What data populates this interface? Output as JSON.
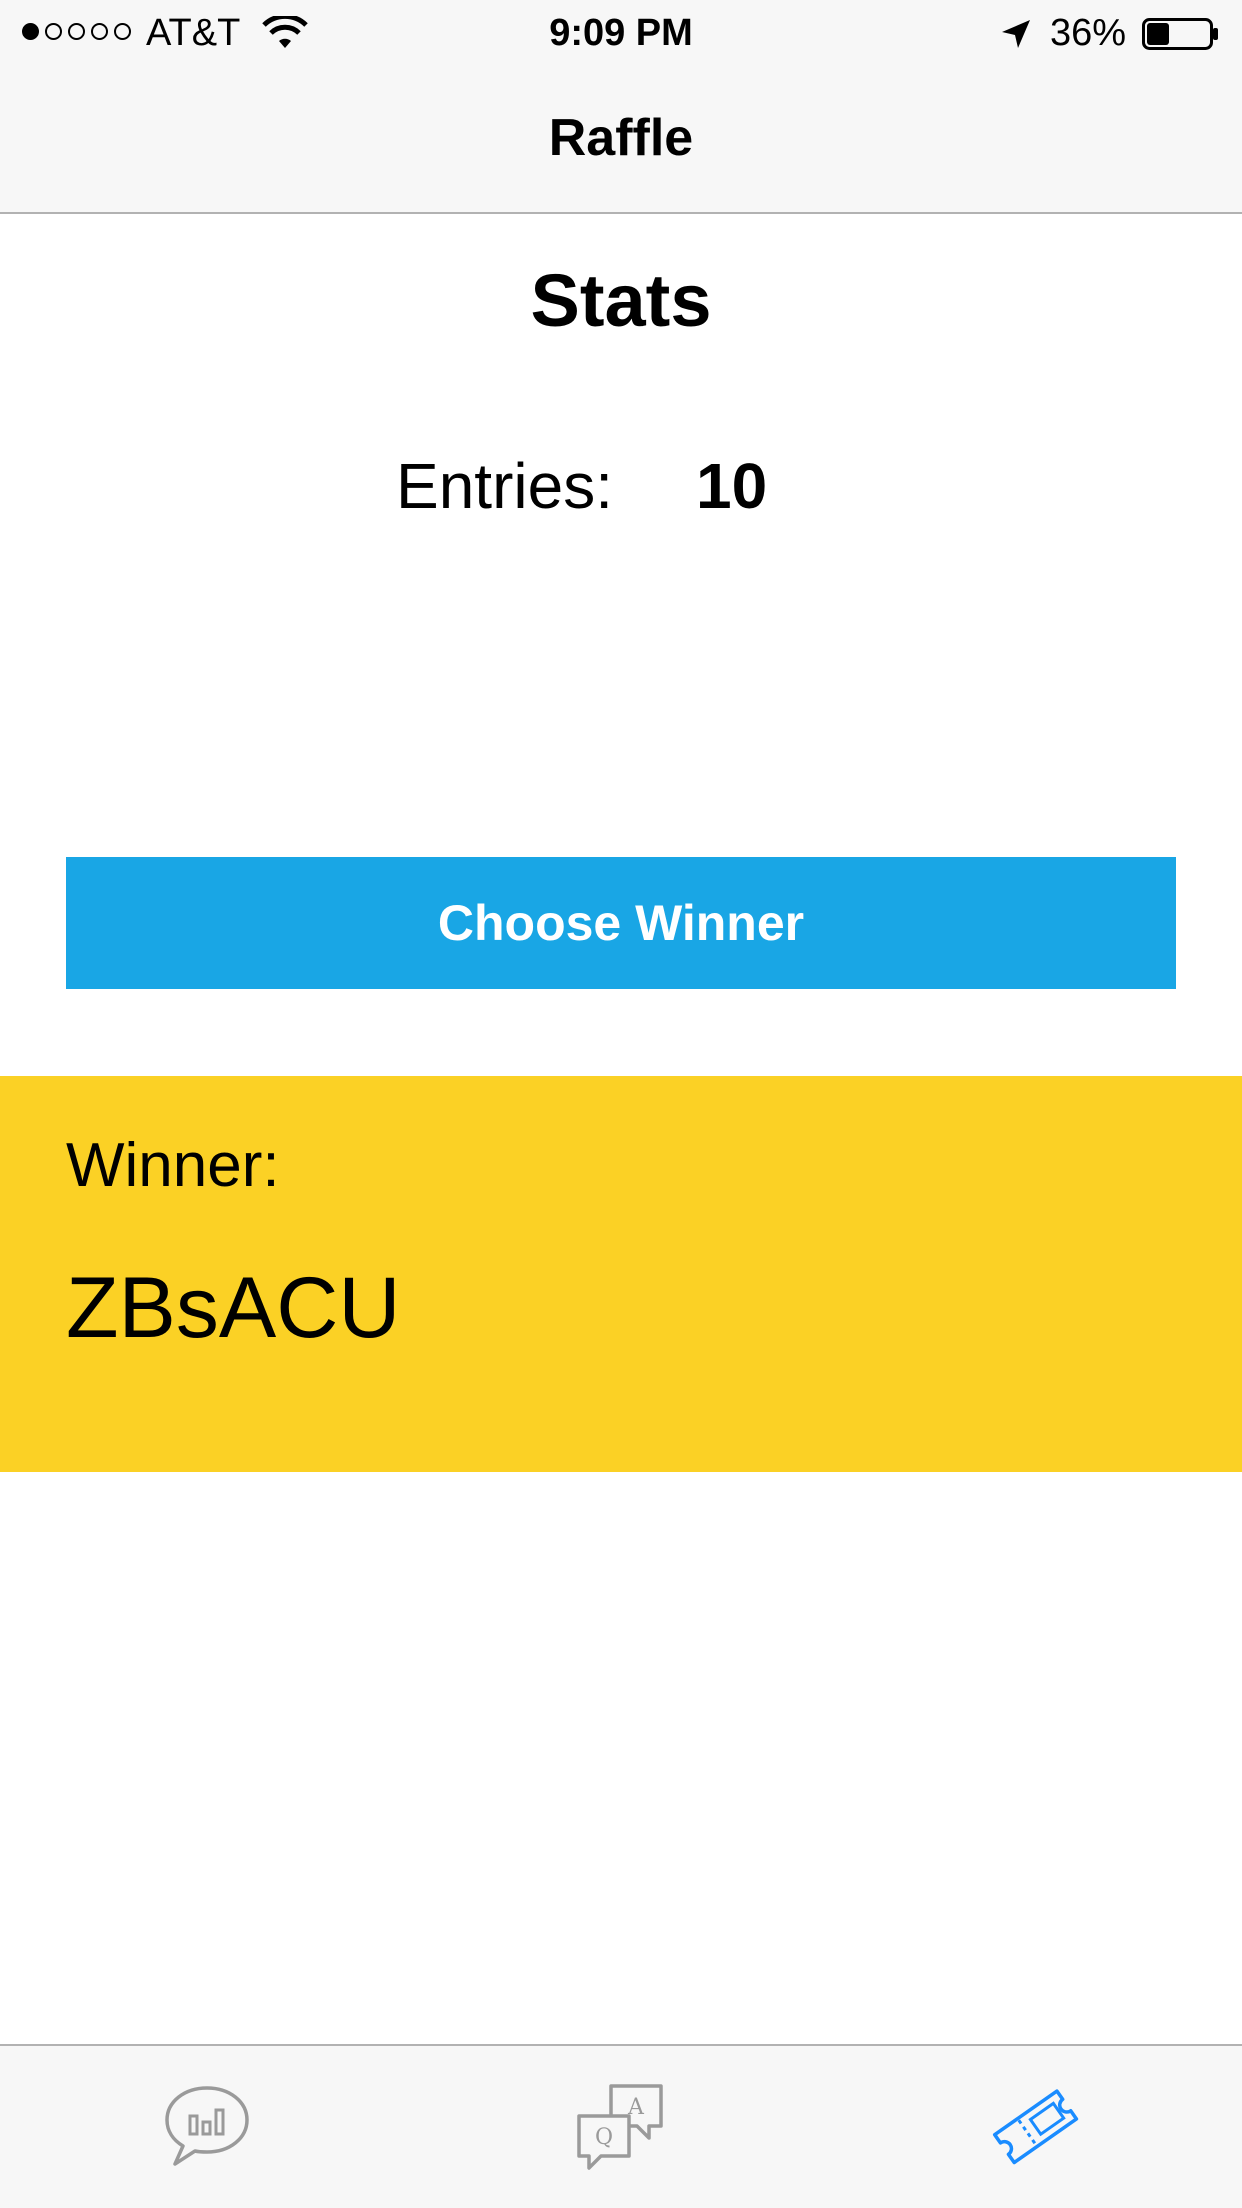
{
  "status_bar": {
    "signal": "●○○○○",
    "carrier": "AT&T",
    "time": "9:09 PM",
    "battery_percent": "36%",
    "battery_level": 0.36,
    "icons": [
      "wifi-icon",
      "location-arrow-icon",
      "battery-icon"
    ]
  },
  "nav": {
    "title": "Raffle"
  },
  "stats": {
    "title": "Stats",
    "entries_label": "Entries:",
    "entries_value": "10"
  },
  "actions": {
    "choose_winner_label": "Choose Winner"
  },
  "winner": {
    "label": "Winner:",
    "name": "ZBsACU"
  },
  "tab_bar": {
    "items": [
      {
        "icon": "poll-chat-icon",
        "selected": false
      },
      {
        "icon": "qa-chat-icon",
        "selected": false
      },
      {
        "icon": "ticket-icon",
        "selected": true
      }
    ]
  },
  "colors": {
    "accent_blue": "#19a6e5",
    "winner_yellow": "#fbd125",
    "tab_selected": "#1a8cff",
    "tab_unselected": "#9a9a9a"
  }
}
